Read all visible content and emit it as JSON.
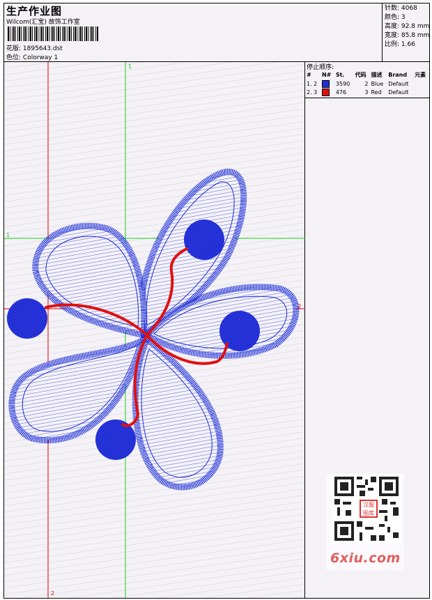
{
  "header": {
    "title": "生产作业图",
    "studio": "Wilcom(汇宝) 故饰工作室",
    "design_file_label": "花版:",
    "design_file": "1895643.dst",
    "colorway_label": "色位:",
    "colorway": "Colorway 1"
  },
  "stats": [
    {
      "label": "针数:",
      "value": "4068"
    },
    {
      "label": "颜色:",
      "value": "3"
    },
    {
      "label": "高度:",
      "value": "92.8 mm"
    },
    {
      "label": "宽度:",
      "value": "85.8 mm"
    },
    {
      "label": "比例:",
      "value": "1.66"
    }
  ],
  "stop_sequence": {
    "title": "停止顺序:",
    "columns": [
      "#",
      "N#",
      "St.",
      "代码",
      "描述",
      "Brand",
      "元素"
    ],
    "rows": [
      {
        "index": "1. 2",
        "color": "#1e2fd6",
        "stitches": "3590",
        "code": "2",
        "description": "Blue",
        "brand": "Default"
      },
      {
        "index": "2. 3",
        "color": "#e01010",
        "stitches": "476",
        "code": "3",
        "description": "Red",
        "brand": "Default"
      }
    ]
  },
  "guides": {
    "green_top": "1",
    "green_left": "1",
    "red_bottom": "2",
    "red_right": "2"
  },
  "watermark": {
    "brand": "6xiu.com",
    "badge": "汉服图库"
  },
  "colors": {
    "thread_blue": "#1e2fd6",
    "thread_red": "#e01010",
    "guide_green": "#18d018",
    "guide_red": "#e00000"
  }
}
